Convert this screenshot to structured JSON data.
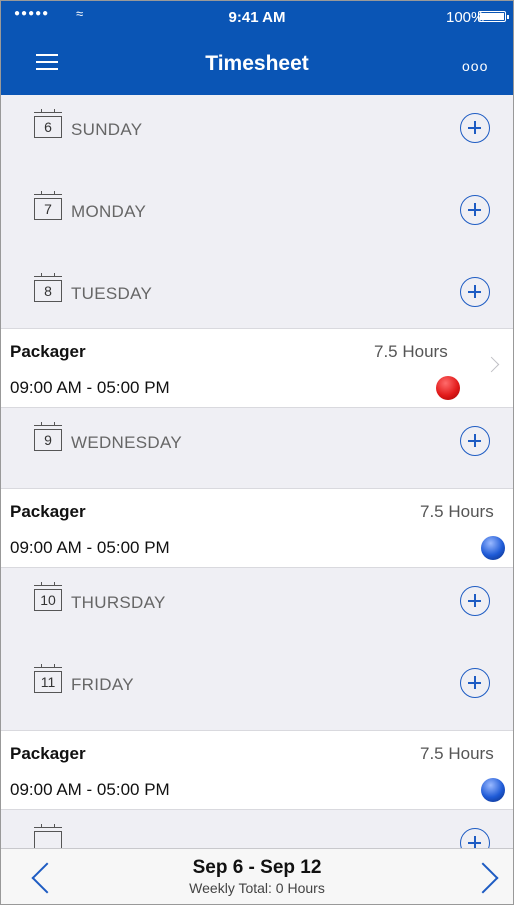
{
  "status_bar": {
    "signal": "●●●●●",
    "time": "9:41 AM",
    "battery_pct": "100%"
  },
  "nav": {
    "title": "Timesheet",
    "menu_icon": "hamburger-icon",
    "more_label": "ooo"
  },
  "days": [
    {
      "date": "6",
      "label": "SUNDAY"
    },
    {
      "date": "7",
      "label": "MONDAY"
    },
    {
      "date": "8",
      "label": "TUESDAY"
    },
    {
      "date": "9",
      "label": "WEDNESDAY"
    },
    {
      "date": "10",
      "label": "THURSDAY"
    },
    {
      "date": "11",
      "label": "FRIDAY"
    }
  ],
  "entries": {
    "tuesday": {
      "title": "Packager",
      "hours": "7.5 Hours",
      "time": "09:00 AM - 05:00 PM",
      "status": "red"
    },
    "wednesday": {
      "title": "Packager",
      "hours": "7.5 Hours",
      "time": "09:00 AM - 05:00 PM",
      "status": "blue"
    },
    "friday": {
      "title": "Packager",
      "hours": "7.5 Hours",
      "time": "09:00 AM - 05:00 PM",
      "status": "blue"
    }
  },
  "footer": {
    "range": "Sep 6 - Sep 12",
    "weekly_total": "Weekly Total: 0 Hours"
  },
  "colors": {
    "brand": "#0a55b5",
    "accent": "#1e5cc3",
    "status_red": "#e21b1b",
    "status_blue": "#1e5ad6"
  }
}
